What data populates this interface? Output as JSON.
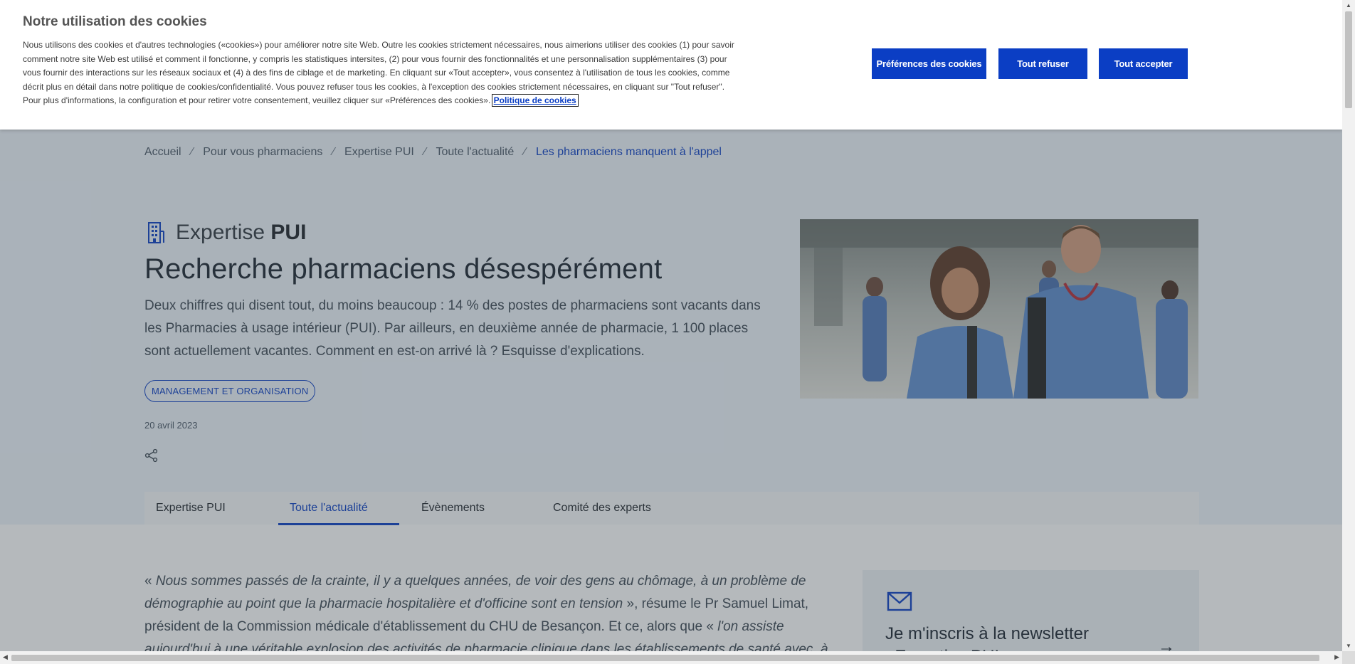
{
  "cookie": {
    "title": "Notre utilisation des cookies",
    "body": "Nous utilisons des cookies et d'autres technologies («cookies») pour améliorer notre site Web. Outre les cookies strictement nécessaires, nous aimerions utiliser des cookies (1) pour savoir comment notre site Web est utilisé et comment il fonctionne, y compris les statistiques intersites, (2) pour vous fournir des fonctionnalités et une personnalisation supplémentaires (3) pour vous fournir des interactions sur les réseaux sociaux et (4) à des fins de ciblage et de marketing. En cliquant sur «Tout accepter», vous consentez à l'utilisation de tous les cookies, comme décrit plus en détail dans notre politique de cookies/confidentialité. Vous pouvez refuser tous les cookies, à l'exception des cookies strictement nécessaires, en cliquant sur \"Tout refuser\". Pour plus d'informations, la configuration et pour retirer votre consentement, veuillez cliquer sur «Préférences des cookies».",
    "policy_link": "Politique de cookies",
    "prefs_button": "Préférences des cookies",
    "refuse_button": "Tout refuser",
    "accept_button": "Tout accepter"
  },
  "breadcrumb": {
    "items": [
      "Accueil",
      "Pour vous pharmaciens",
      "Expertise PUI",
      "Toute l'actualité"
    ],
    "current": "Les pharmaciens manquent à l'appel",
    "separator": "⁄"
  },
  "section": {
    "name_light": "Expertise",
    "name_bold": "PUI",
    "icon": "building-icon"
  },
  "article": {
    "title": "Recherche pharmaciens désespérément",
    "intro": "Deux chiffres qui disent tout, du moins beaucoup : 14 % des postes de pharmaciens sont vacants dans les Pharmacies à usage intérieur (PUI). Par ailleurs, en deuxième année de pharmacie, 1 100 places sont actuellement vacantes. Comment en est-on arrivé là ? Esquisse d'explications.",
    "tag": "MANAGEMENT ET ORGANISATION",
    "date": "20 avril 2023",
    "share_icon": "share-icon",
    "body_quote_open": "« ",
    "body_italic_1": "Nous sommes passés de la crainte, il y a quelques années, de voir des gens au chômage, à un problème de démographie au point que la pharmacie hospitalière et d'officine sont en tension",
    "body_plain": " », résume le Pr Samuel Limat, président de la Commission médicale d'établissement du CHU de Besançon. Et ce, alors que « ",
    "body_italic_2": "l'on assiste aujourd'hui à une véritable explosion des activités de pharmacie clinique dans les établissements de santé avec, à la clef, des créations"
  },
  "tabs": [
    {
      "label": "Expertise PUI",
      "active": false
    },
    {
      "label": "Toute l'actualité",
      "active": true
    },
    {
      "label": "Évènements",
      "active": false
    },
    {
      "label": "Comité des experts",
      "active": false
    }
  ],
  "newsletter": {
    "title": "Je m'inscris à la newsletter «Expertise PUI»",
    "icon": "mail-icon",
    "arrow_icon": "arrow-right-icon"
  },
  "colors": {
    "accent": "#0b3ec4",
    "hero_bg": "#eef4fb"
  }
}
